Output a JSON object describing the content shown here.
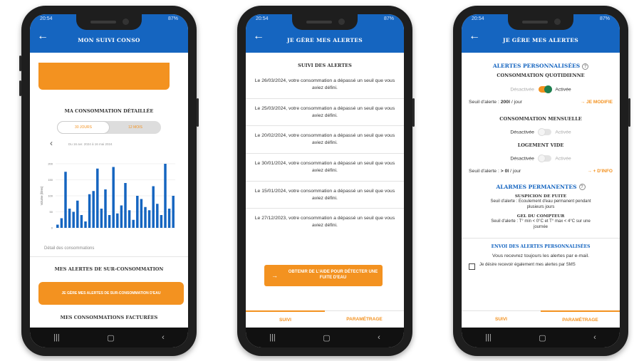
{
  "status": {
    "left": "20:54",
    "right": "87%"
  },
  "phone1": {
    "title": "MON SUIVI CONSO",
    "detail_title": "MA CONSOMMATION DÉTAILLÉE",
    "toggle": [
      "30 JOURS",
      "12 MOIS"
    ],
    "date_range": "Du 16 avr. 2024 à 16 mai 2024",
    "detail_link": "Détail des consommations",
    "alerts_title": "MES ALERTES DE SUR-CONSOMMATION",
    "alerts_button": "JE GÈRE MES ALERTES DE SUR-CONSOMMATION D'EAU",
    "billed_title": "MES CONSOMMATIONS FACTURÉES"
  },
  "phone2": {
    "title": "JE GÈRE MES ALERTES",
    "section": "SUIVI DES ALERTES",
    "alerts": [
      "Le 26/03/2024, votre consommation a dépassé un seuil que vous aviez défini.",
      "Le 25/03/2024, votre consommation a dépassé un seuil que vous aviez défini.",
      "Le 20/02/2024, votre consommation a dépassé un seuil que vous aviez défini.",
      "Le 30/01/2024, votre consommation a dépassé un seuil que vous aviez défini.",
      "Le 15/01/2024, votre consommation a dépassé un seuil que vous aviez défini.",
      "Le 27/12/2023, votre consommation a dépassé un seuil que vous aviez défini."
    ],
    "help_button": "OBTENIR DE L'AIDE POUR DÉTECTER UNE FUITE D'EAU",
    "tabs": [
      "SUIVI",
      "PARAMÉTRAGE"
    ]
  },
  "phone3": {
    "title": "JE GÈRE MES ALERTES",
    "perso_title": "ALERTES PERSONNALISÉES",
    "daily_title": "CONSOMMATION QUOTIDIENNE",
    "off": "Désactivée",
    "on": "Activée",
    "daily_threshold_label": "Seuil d'alerte :",
    "daily_threshold_value": "200l",
    "daily_threshold_unit": "/ jour",
    "modify_link": "→ JE MODIFIE",
    "monthly_title": "CONSOMMATION MENSUELLE",
    "empty_title": "LOGEMENT VIDE",
    "empty_threshold_label": "Seuil d'alerte :",
    "empty_threshold_value": "> 0l",
    "empty_threshold_unit": "/ jour",
    "info_link": "→ + D'INFO",
    "perm_title": "ALARMES PERMANENTES",
    "leak_title": "SUSPICION DE FUITE",
    "leak_text": "Seuil d'alerte : Ecoulement d'eau permanent pendant plusieurs jours",
    "frost_title": "GEL DU COMPTEUR",
    "frost_text": "Seuil d'alerte : T° min < 0°C et T° max < 4°C sur une journée",
    "send_title": "ENVOI DES ALERTES PERSONNALISÉES",
    "send_text": "Vous recevrez toujours les alertes par e-mail.",
    "sms_label": "Je désire recevoir également mes alertes par SMS",
    "tabs": [
      "SUIVI",
      "PARAMÉTRAGE"
    ]
  },
  "colors": {
    "blue": "#1565c0",
    "orange": "#f39220",
    "green": "#1e7f4f"
  },
  "chart_data": {
    "type": "bar",
    "ylabel": "Volume (litres)",
    "ylim": [
      0,
      200
    ],
    "yticks": [
      0,
      50,
      100,
      150,
      200
    ],
    "values": [
      10,
      30,
      175,
      60,
      50,
      85,
      40,
      20,
      105,
      115,
      185,
      60,
      120,
      40,
      190,
      45,
      70,
      140,
      55,
      25,
      100,
      90,
      65,
      55,
      130,
      75,
      40,
      200,
      60,
      100
    ]
  }
}
